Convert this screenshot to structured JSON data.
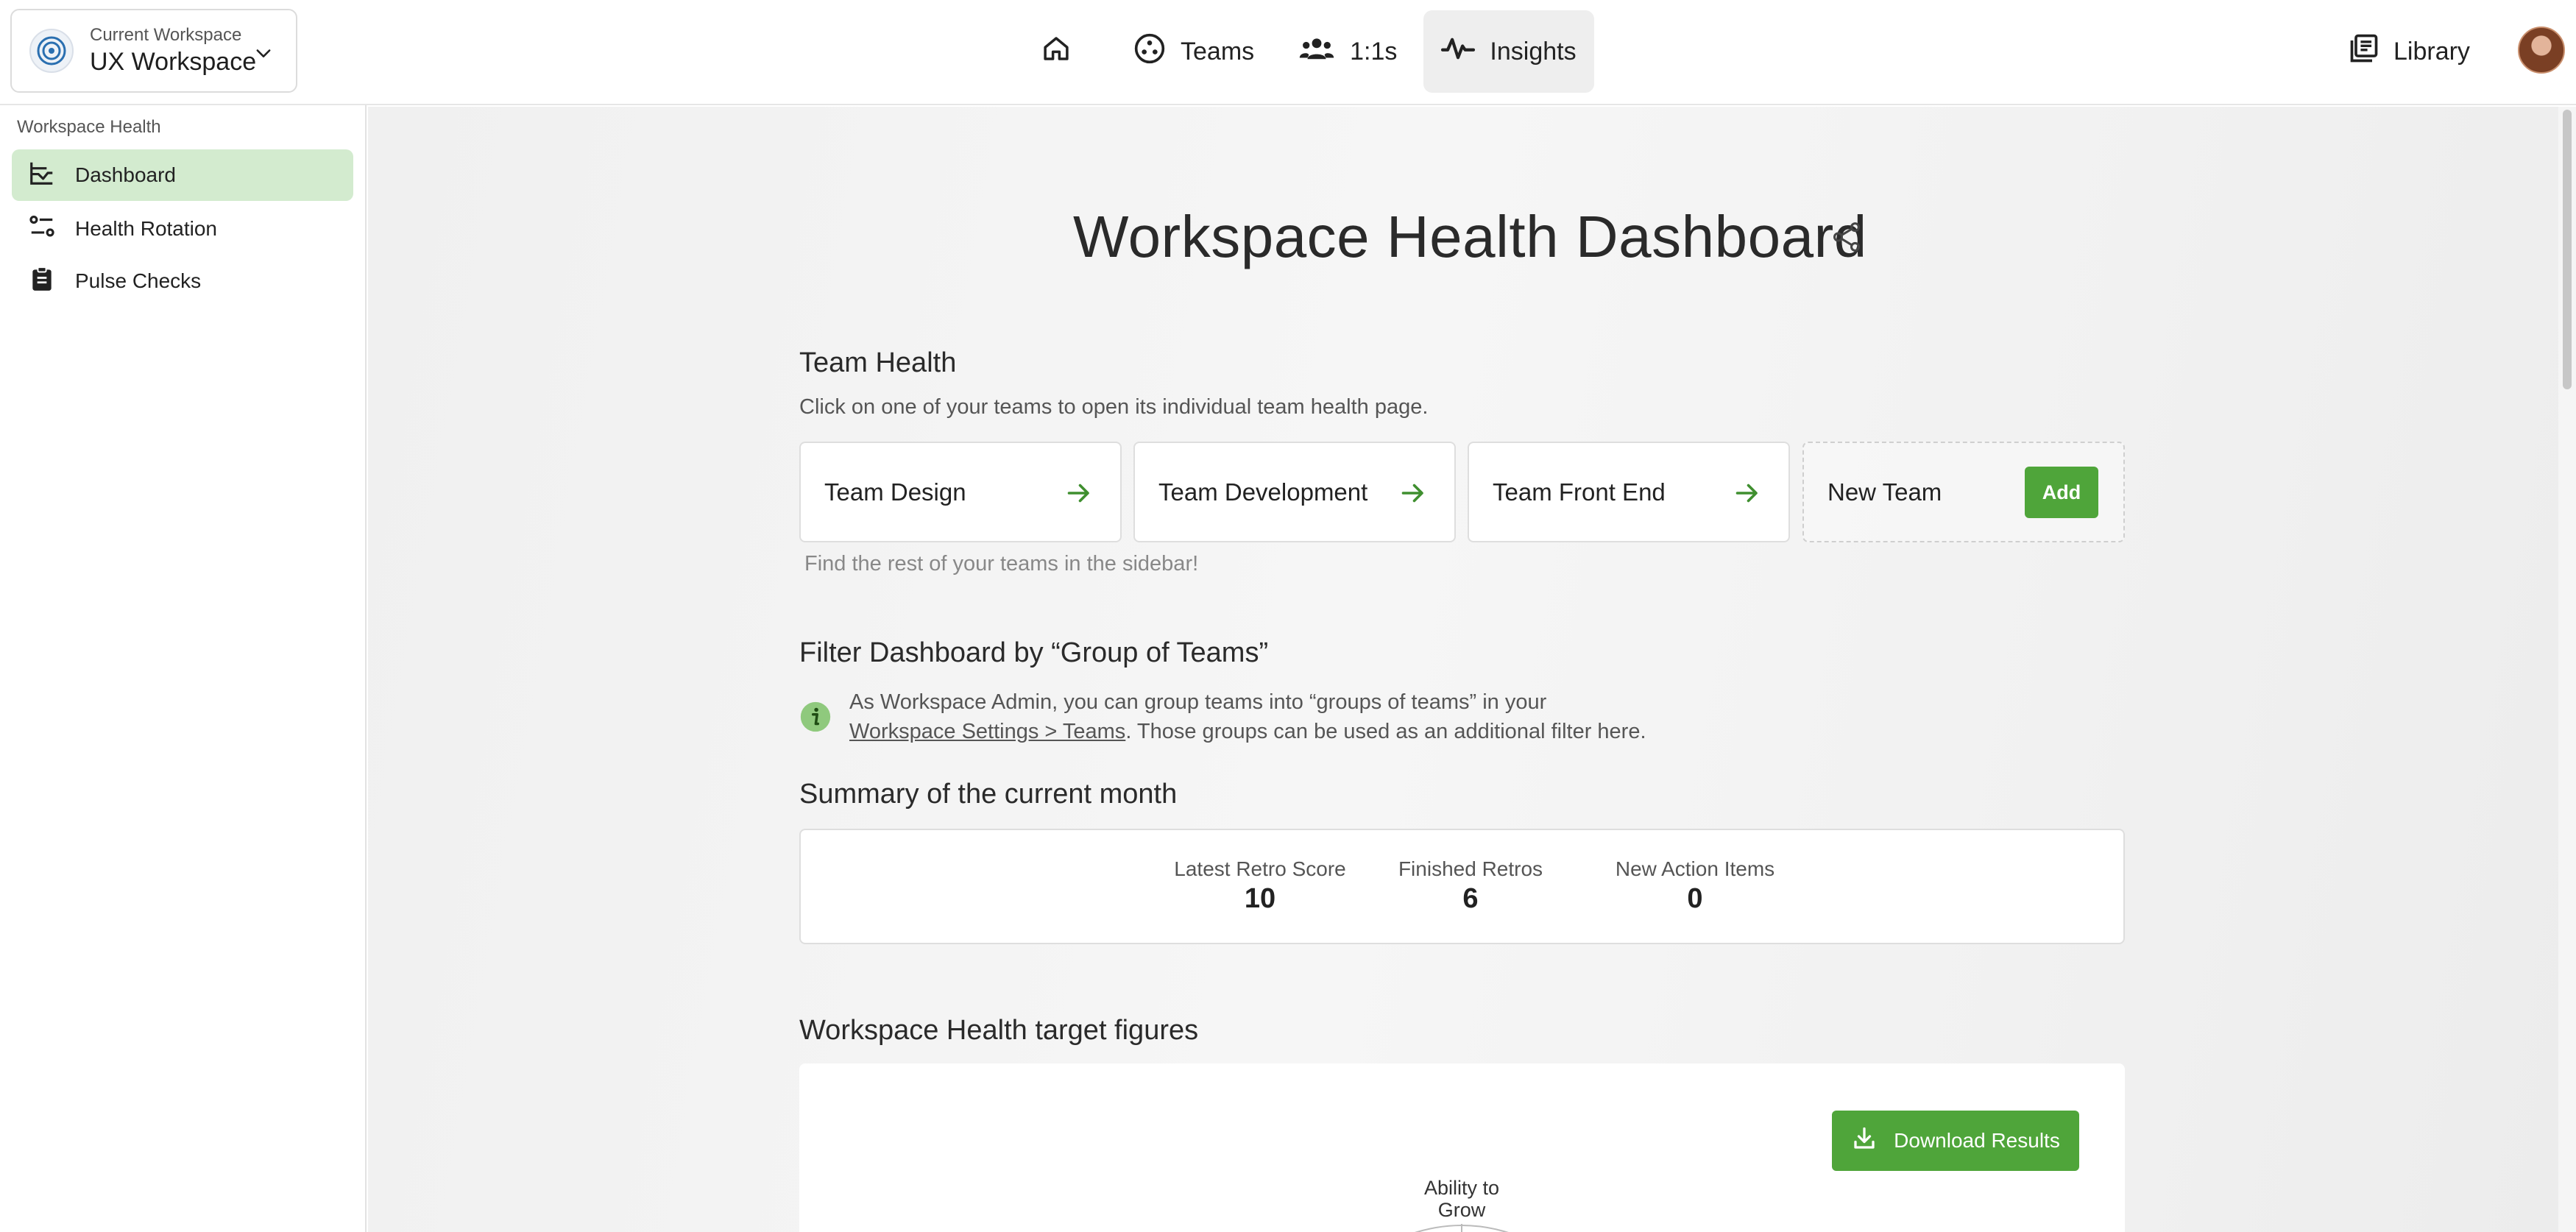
{
  "workspace": {
    "caption": "Current Workspace",
    "name": "UX Workspace"
  },
  "nav": {
    "items": [
      {
        "label": "",
        "icon": "home-icon"
      },
      {
        "label": "Teams",
        "icon": "teams-icon"
      },
      {
        "label": "1:1s",
        "icon": "people-icon"
      },
      {
        "label": "Insights",
        "icon": "insights-icon",
        "active": true
      }
    ],
    "library": "Library"
  },
  "sidebar": {
    "heading": "Workspace Health",
    "items": [
      {
        "label": "Dashboard",
        "icon": "dashboard-icon",
        "active": true
      },
      {
        "label": "Health Rotation",
        "icon": "rotation-icon"
      },
      {
        "label": "Pulse Checks",
        "icon": "clipboard-icon"
      }
    ]
  },
  "page": {
    "title": "Workspace Health Dashboard"
  },
  "team_health": {
    "title": "Team Health",
    "description": "Click on one of your teams to open its individual team health page.",
    "teams": [
      "Team Design",
      "Team Development",
      "Team Front End"
    ],
    "new_team": "New Team",
    "add": "Add",
    "hint": "Find the rest of your teams in the sidebar!"
  },
  "filter": {
    "title": "Filter Dashboard by “Group of Teams”",
    "info_line1": "As Workspace Admin, you can group teams into “groups of teams” in your",
    "link": "Workspace Settings > Teams",
    "info_line2_rest": ". Those groups can be used as an additional filter here."
  },
  "summary": {
    "title": "Summary of the current month",
    "metrics": [
      {
        "label": "Latest Retro Score",
        "value": "10"
      },
      {
        "label": "Finished Retros",
        "value": "6"
      },
      {
        "label": "New Action Items",
        "value": "0"
      }
    ]
  },
  "figures": {
    "title": "Workspace Health target figures",
    "download": "Download Results",
    "radar_label_line1": "Ability to",
    "radar_label_line2": "Grow"
  },
  "colors": {
    "accent": "#4fa53a",
    "active_sidebar": "#d3ebcf"
  }
}
